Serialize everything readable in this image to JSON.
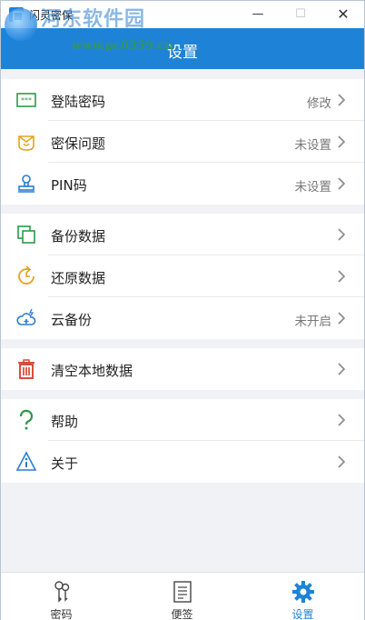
{
  "window": {
    "title": "闪灵密保"
  },
  "header": {
    "title": "设置"
  },
  "watermark": {
    "text": "河东软件园",
    "url": "www.pc0359.cn"
  },
  "groups": [
    {
      "items": [
        {
          "label": "登陆密码",
          "value": "修改",
          "icon": "password-icon"
        },
        {
          "label": "密保问题",
          "value": "未设置",
          "icon": "security-question-icon"
        },
        {
          "label": "PIN码",
          "value": "未设置",
          "icon": "pin-stamp-icon"
        }
      ]
    },
    {
      "items": [
        {
          "label": "备份数据",
          "value": "",
          "icon": "backup-icon"
        },
        {
          "label": "还原数据",
          "value": "",
          "icon": "restore-icon"
        },
        {
          "label": "云备份",
          "value": "未开启",
          "icon": "cloud-backup-icon"
        }
      ]
    },
    {
      "items": [
        {
          "label": "清空本地数据",
          "value": "",
          "icon": "trash-icon"
        }
      ]
    },
    {
      "items": [
        {
          "label": "帮助",
          "value": "",
          "icon": "help-icon"
        },
        {
          "label": "关于",
          "value": "",
          "icon": "about-icon"
        }
      ]
    }
  ],
  "tabs": [
    {
      "label": "密码",
      "icon": "keys-icon",
      "active": false
    },
    {
      "label": "便签",
      "icon": "note-icon",
      "active": false
    },
    {
      "label": "设置",
      "icon": "gear-icon",
      "active": true
    }
  ],
  "colors": {
    "accent": "#1e83d6",
    "background": "#f0f2f5"
  }
}
